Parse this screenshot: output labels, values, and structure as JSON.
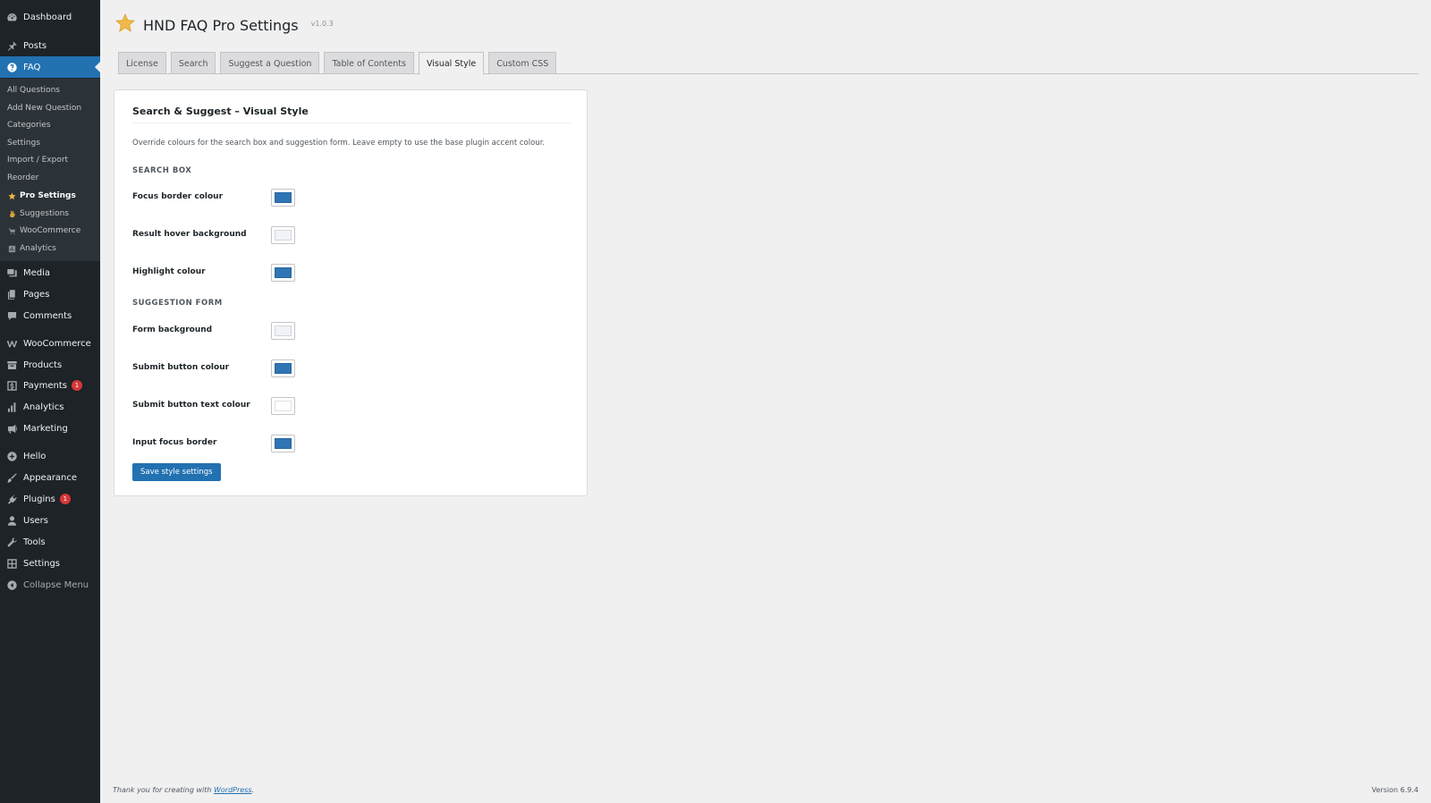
{
  "sidebar": {
    "top_items": [
      {
        "label": "Dashboard",
        "icon": "dashboard-icon"
      },
      {
        "label": "Posts",
        "icon": "pin-icon"
      },
      {
        "label": "FAQ",
        "icon": "question-icon"
      }
    ],
    "faq_submenu": [
      {
        "label": "All Questions"
      },
      {
        "label": "Add New Question"
      },
      {
        "label": "Categories"
      },
      {
        "label": "Settings"
      },
      {
        "label": "Import / Export"
      },
      {
        "label": "Reorder"
      },
      {
        "label": "Pro Settings",
        "icon": "star-icon"
      },
      {
        "label": "Suggestions",
        "icon": "hand-icon"
      },
      {
        "label": "WooCommerce",
        "icon": "cart-icon"
      },
      {
        "label": "Analytics",
        "icon": "chart-icon"
      }
    ],
    "lower_items": [
      {
        "label": "Media",
        "icon": "media-icon"
      },
      {
        "label": "Pages",
        "icon": "pages-icon"
      },
      {
        "label": "Comments",
        "icon": "comment-icon"
      },
      {
        "label": "WooCommerce",
        "icon": "woo-icon"
      },
      {
        "label": "Products",
        "icon": "archive-icon"
      },
      {
        "label": "Payments",
        "icon": "dollar-icon",
        "badge": "1"
      },
      {
        "label": "Analytics",
        "icon": "bar-chart-icon"
      },
      {
        "label": "Marketing",
        "icon": "megaphone-icon"
      },
      {
        "label": "Hello",
        "icon": "plus-circle-icon"
      },
      {
        "label": "Appearance",
        "icon": "brush-icon"
      },
      {
        "label": "Plugins",
        "icon": "plugin-icon",
        "badge": "1"
      },
      {
        "label": "Users",
        "icon": "user-icon"
      },
      {
        "label": "Tools",
        "icon": "wrench-icon"
      },
      {
        "label": "Settings",
        "icon": "settings-icon"
      },
      {
        "label": "Collapse Menu",
        "icon": "collapse-icon"
      }
    ]
  },
  "header": {
    "title": "HND FAQ Pro Settings",
    "version": "v1.0.3"
  },
  "tabs": [
    {
      "label": "License"
    },
    {
      "label": "Search"
    },
    {
      "label": "Suggest a Question"
    },
    {
      "label": "Table of Contents"
    },
    {
      "label": "Visual Style",
      "active": true
    },
    {
      "label": "Custom CSS"
    }
  ],
  "card": {
    "title": "Search & Suggest – Visual Style",
    "description": "Override colours for the search box and suggestion form. Leave empty to use the base plugin accent colour.",
    "search_section": "SEARCH BOX",
    "suggestion_section": "SUGGESTION FORM",
    "search_rows": [
      {
        "label": "Focus border colour",
        "color": "#2f75b5"
      },
      {
        "label": "Result hover background",
        "color": "#f0f3f7"
      },
      {
        "label": "Highlight colour",
        "color": "#2f75b5"
      }
    ],
    "suggestion_rows": [
      {
        "label": "Form background",
        "color": "#f0f3f7"
      },
      {
        "label": "Submit button colour",
        "color": "#2f75b5"
      },
      {
        "label": "Submit button text colour",
        "color": "#ffffff"
      },
      {
        "label": "Input focus border",
        "color": "#2f75b5"
      }
    ],
    "save_label": "Save style settings"
  },
  "footer": {
    "thanks_prefix": "Thank you for creating with ",
    "thanks_link": "WordPress",
    "thanks_suffix": ".",
    "version": "Version 6.9.4"
  },
  "colors": {
    "sidebar_bg": "#1d2327",
    "accent": "#2271b1",
    "badge": "#d63638",
    "star": "#f0b849"
  }
}
